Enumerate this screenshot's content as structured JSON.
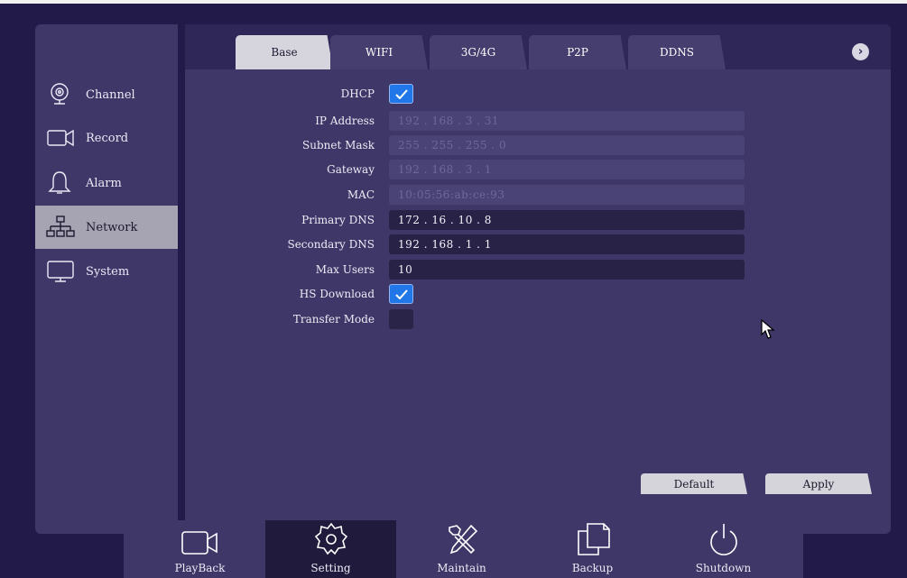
{
  "sidebar": {
    "items": [
      {
        "label": "Channel",
        "icon": "webcam-icon"
      },
      {
        "label": "Record",
        "icon": "video-camera-icon"
      },
      {
        "label": "Alarm",
        "icon": "bell-icon"
      },
      {
        "label": "Network",
        "icon": "network-icon",
        "active": true
      },
      {
        "label": "System",
        "icon": "monitor-icon"
      }
    ]
  },
  "tabs": {
    "items": [
      {
        "label": "Base",
        "active": true
      },
      {
        "label": "WIFI"
      },
      {
        "label": "3G/4G"
      },
      {
        "label": "P2P"
      },
      {
        "label": "DDNS"
      }
    ],
    "next_icon": "chevron-right-icon"
  },
  "form": {
    "dhcp": {
      "label": "DHCP",
      "checked": true
    },
    "ip_address": {
      "label": "IP Address",
      "value": "192 .  168 .  3    .  31",
      "enabled": false
    },
    "subnet_mask": {
      "label": "Subnet Mask",
      "value": "255 .  255 .  255 .  0",
      "enabled": false
    },
    "gateway": {
      "label": "Gateway",
      "value": "192 .  168 .  3    .  1",
      "enabled": false
    },
    "mac": {
      "label": "MAC",
      "value": "10:05:56:ab:ce:93",
      "enabled": false
    },
    "primary_dns": {
      "label": "Primary DNS",
      "value": "172 .  16  .  10  .  8",
      "enabled": true
    },
    "secondary_dns": {
      "label": "Secondary DNS",
      "value": "192 .  168 .  1    .  1",
      "enabled": true
    },
    "max_users": {
      "label": "Max Users",
      "value": "10",
      "enabled": true
    },
    "hs_download": {
      "label": "HS Download",
      "checked": true
    },
    "transfer_mode": {
      "label": "Transfer Mode",
      "checked": false
    }
  },
  "buttons": {
    "default_label": "Default",
    "apply_label": "Apply"
  },
  "bottom_bar": {
    "items": [
      {
        "label": "PlayBack",
        "icon": "video-camera-icon"
      },
      {
        "label": "Setting",
        "icon": "gear-icon",
        "active": true
      },
      {
        "label": "Maintain",
        "icon": "tools-icon"
      },
      {
        "label": "Backup",
        "icon": "copy-icon"
      },
      {
        "label": "Shutdown",
        "icon": "power-icon"
      }
    ]
  },
  "colors": {
    "background": "#221a48",
    "panel": "#3f3768",
    "tab_bar": "#2e2757",
    "checkbox_checked": "#2277e8",
    "sidebar_active": "#a6a4b2"
  }
}
